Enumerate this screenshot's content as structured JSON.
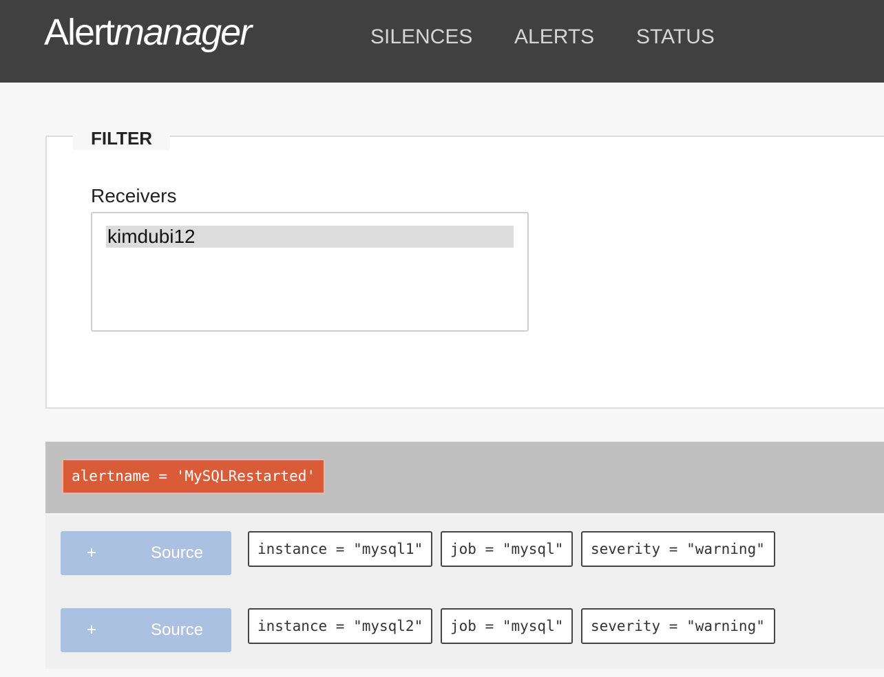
{
  "brand": {
    "part1": "Alert",
    "part2": "manager"
  },
  "nav": {
    "silences": "SILENCES",
    "alerts": "ALERTS",
    "status": "STATUS"
  },
  "filter": {
    "legend": "FILTER",
    "receivers_label": "Receivers",
    "receivers": [
      "kimdubi12"
    ]
  },
  "group": {
    "label": "alertname = 'MySQLRestarted'"
  },
  "alerts": [
    {
      "source_icon": "+",
      "source_label": "Source",
      "labels": [
        "instance = \"mysql1\"",
        "job = \"mysql\"",
        "severity = \"warning\""
      ]
    },
    {
      "source_icon": "+",
      "source_label": "Source",
      "labels": [
        "instance = \"mysql2\"",
        "job = \"mysql\"",
        "severity = \"warning\""
      ]
    }
  ],
  "colors": {
    "navbar": "#404040",
    "group_label": "#d95b38",
    "source_button": "#abc1e2"
  }
}
